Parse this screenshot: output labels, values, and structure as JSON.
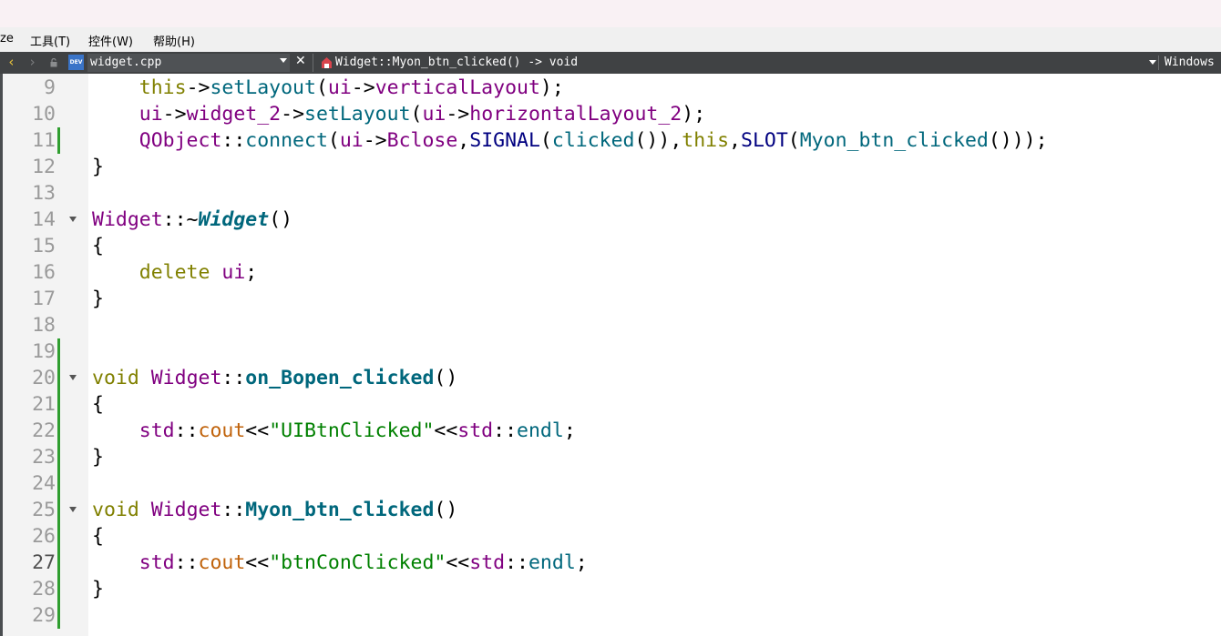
{
  "menu": {
    "partial": "ze",
    "tools": "工具(T)",
    "controls": "控件(W)",
    "help": "帮助(H)"
  },
  "toolbar": {
    "file_name": "widget.cpp",
    "file_badge": "DEV",
    "function_path": "Widget::Myon_btn_clicked() -> void",
    "line_ending": "Windows"
  },
  "editor": {
    "current_line": "27",
    "lines": [
      {
        "n": "9",
        "segs": [
          [
            "    ",
            ""
          ],
          [
            "this",
            "kw"
          ],
          [
            "->",
            ""
          ],
          [
            "setLayout",
            "fn"
          ],
          [
            "(",
            ""
          ],
          [
            "ui",
            "ty"
          ],
          [
            "->",
            ""
          ],
          [
            "verticalLayout",
            "ty"
          ],
          [
            ");",
            ""
          ]
        ]
      },
      {
        "n": "10",
        "segs": [
          [
            "    ",
            ""
          ],
          [
            "ui",
            "ty"
          ],
          [
            "->",
            ""
          ],
          [
            "widget_2",
            "ty"
          ],
          [
            "->",
            ""
          ],
          [
            "setLayout",
            "fn"
          ],
          [
            "(",
            ""
          ],
          [
            "ui",
            "ty"
          ],
          [
            "->",
            ""
          ],
          [
            "horizontalLayout_2",
            "ty"
          ],
          [
            ");",
            ""
          ]
        ]
      },
      {
        "n": "11",
        "segs": [
          [
            "    ",
            ""
          ],
          [
            "QObject",
            "ty"
          ],
          [
            "::",
            ""
          ],
          [
            "connect",
            "fn"
          ],
          [
            "(",
            ""
          ],
          [
            "ui",
            "ty"
          ],
          [
            "->",
            ""
          ],
          [
            "Bclose",
            "ty"
          ],
          [
            ",",
            ""
          ],
          [
            "SIGNAL",
            "mac"
          ],
          [
            "(",
            ""
          ],
          [
            "clicked",
            "fn"
          ],
          [
            "()),",
            ""
          ],
          [
            "this",
            "kw"
          ],
          [
            ",",
            ""
          ],
          [
            "SLOT",
            "mac"
          ],
          [
            "(",
            ""
          ],
          [
            "Myon_btn_clicked",
            "fn"
          ],
          [
            "()));",
            ""
          ]
        ]
      },
      {
        "n": "12",
        "segs": [
          [
            "}",
            ""
          ]
        ]
      },
      {
        "n": "13",
        "segs": []
      },
      {
        "n": "14",
        "segs": [
          [
            "Widget",
            "ty"
          ],
          [
            "::~",
            ""
          ],
          [
            "Widget",
            "fni"
          ],
          [
            "()",
            ""
          ]
        ]
      },
      {
        "n": "15",
        "segs": [
          [
            "{",
            ""
          ]
        ]
      },
      {
        "n": "16",
        "segs": [
          [
            "    ",
            ""
          ],
          [
            "delete",
            "kw"
          ],
          [
            " ",
            ""
          ],
          [
            "ui",
            "ty"
          ],
          [
            ";",
            ""
          ]
        ]
      },
      {
        "n": "17",
        "segs": [
          [
            "}",
            ""
          ]
        ]
      },
      {
        "n": "18",
        "segs": []
      },
      {
        "n": "19",
        "segs": []
      },
      {
        "n": "20",
        "segs": [
          [
            "void",
            "kw"
          ],
          [
            " ",
            ""
          ],
          [
            "Widget",
            "ty"
          ],
          [
            "::",
            ""
          ],
          [
            "on_Bopen_clicked",
            "fnb"
          ],
          [
            "()",
            ""
          ]
        ]
      },
      {
        "n": "21",
        "segs": [
          [
            "{",
            ""
          ]
        ]
      },
      {
        "n": "22",
        "segs": [
          [
            "    ",
            ""
          ],
          [
            "std",
            "ty"
          ],
          [
            "::",
            ""
          ],
          [
            "cout",
            "cout"
          ],
          [
            "<<",
            ""
          ],
          [
            "\"UIBtnClicked\"",
            "str"
          ],
          [
            "<<",
            ""
          ],
          [
            "std",
            "ty"
          ],
          [
            "::",
            ""
          ],
          [
            "endl",
            "fn"
          ],
          [
            ";",
            ""
          ]
        ]
      },
      {
        "n": "23",
        "segs": [
          [
            "}",
            ""
          ]
        ]
      },
      {
        "n": "24",
        "segs": []
      },
      {
        "n": "25",
        "segs": [
          [
            "void",
            "kw"
          ],
          [
            " ",
            ""
          ],
          [
            "Widget",
            "ty"
          ],
          [
            "::",
            ""
          ],
          [
            "Myon_btn_clicked",
            "fnb"
          ],
          [
            "()",
            ""
          ]
        ]
      },
      {
        "n": "26",
        "segs": [
          [
            "{",
            ""
          ]
        ]
      },
      {
        "n": "27",
        "segs": [
          [
            "    ",
            ""
          ],
          [
            "std",
            "ty"
          ],
          [
            "::",
            ""
          ],
          [
            "cout",
            "cout"
          ],
          [
            "<<",
            ""
          ],
          [
            "\"btnConClicked\"",
            "str"
          ],
          [
            "<<",
            ""
          ],
          [
            "std",
            "ty"
          ],
          [
            "::",
            ""
          ],
          [
            "endl",
            "fn"
          ],
          [
            ";",
            ""
          ]
        ]
      },
      {
        "n": "28",
        "segs": [
          [
            "}",
            ""
          ]
        ]
      },
      {
        "n": "29",
        "segs": []
      }
    ]
  }
}
